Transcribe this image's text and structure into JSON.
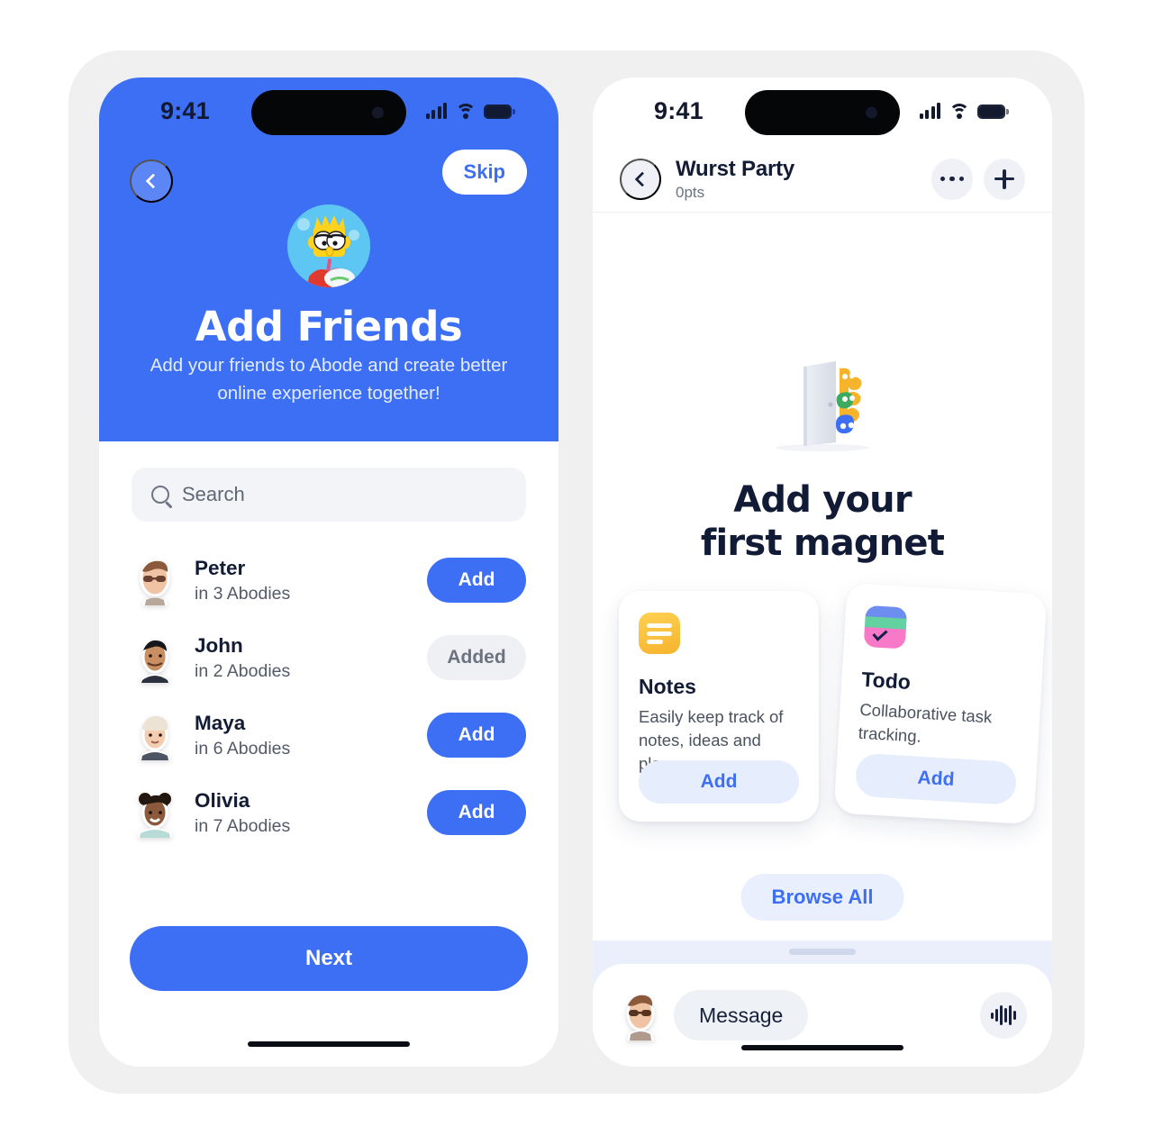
{
  "theme": {
    "brand_blue": "#3d6ff5",
    "navy": "#131c35",
    "light_gray": "#eff1f6",
    "panel_bg": "#f0f0f1",
    "soft_blue": "#e6edfd",
    "sheet_gap": "#eaeffb"
  },
  "left_phone": {
    "status_bar": {
      "time": "9:41",
      "icons": [
        "cellular-signal-icon",
        "wifi-icon",
        "battery-icon"
      ]
    },
    "nav": {
      "back_icon": "chevron-left-icon",
      "skip_label": "Skip"
    },
    "hero": {
      "avatar_icon": "bart-avatar",
      "title": "Add Friends",
      "subtitle": "Add your friends to Abode and create better online experience together!"
    },
    "search": {
      "icon": "search-icon",
      "placeholder": "Search",
      "value": ""
    },
    "friends": [
      {
        "name": "Peter",
        "subtitle": "in 3 Abodies",
        "action": "Add",
        "state": "add"
      },
      {
        "name": "John",
        "subtitle": "in 2 Abodies",
        "action": "Added",
        "state": "added"
      },
      {
        "name": "Maya",
        "subtitle": "in 6 Abodies",
        "action": "Add",
        "state": "add"
      },
      {
        "name": "Olivia",
        "subtitle": "in 7 Abodies",
        "action": "Add",
        "state": "add"
      }
    ],
    "footer": {
      "next_label": "Next"
    }
  },
  "right_phone": {
    "status_bar": {
      "time": "9:41",
      "icons": [
        "cellular-signal-icon",
        "wifi-icon",
        "battery-icon"
      ]
    },
    "header": {
      "back_icon": "chevron-left-icon",
      "title": "Wurst Party",
      "points": "0pts",
      "more_icon": "more-horizontal-icon",
      "add_icon": "plus-icon"
    },
    "empty_state": {
      "illustration": "door-with-magnets-illustration",
      "title_line1": "Add your",
      "title_line2": "first magnet"
    },
    "magnet_cards": [
      {
        "icon": "notes-icon",
        "name": "Notes",
        "description": "Easily keep track of notes, ideas and plans.",
        "action": "Add"
      },
      {
        "icon": "todo-checkmark-icon",
        "name": "Todo",
        "description": "Collaborative task tracking.",
        "action": "Add"
      }
    ],
    "browse_all_label": "Browse All",
    "message_bar": {
      "avatar_icon": "user-avatar",
      "placeholder": "Message",
      "voice_icon": "voice-waveform-icon"
    }
  }
}
